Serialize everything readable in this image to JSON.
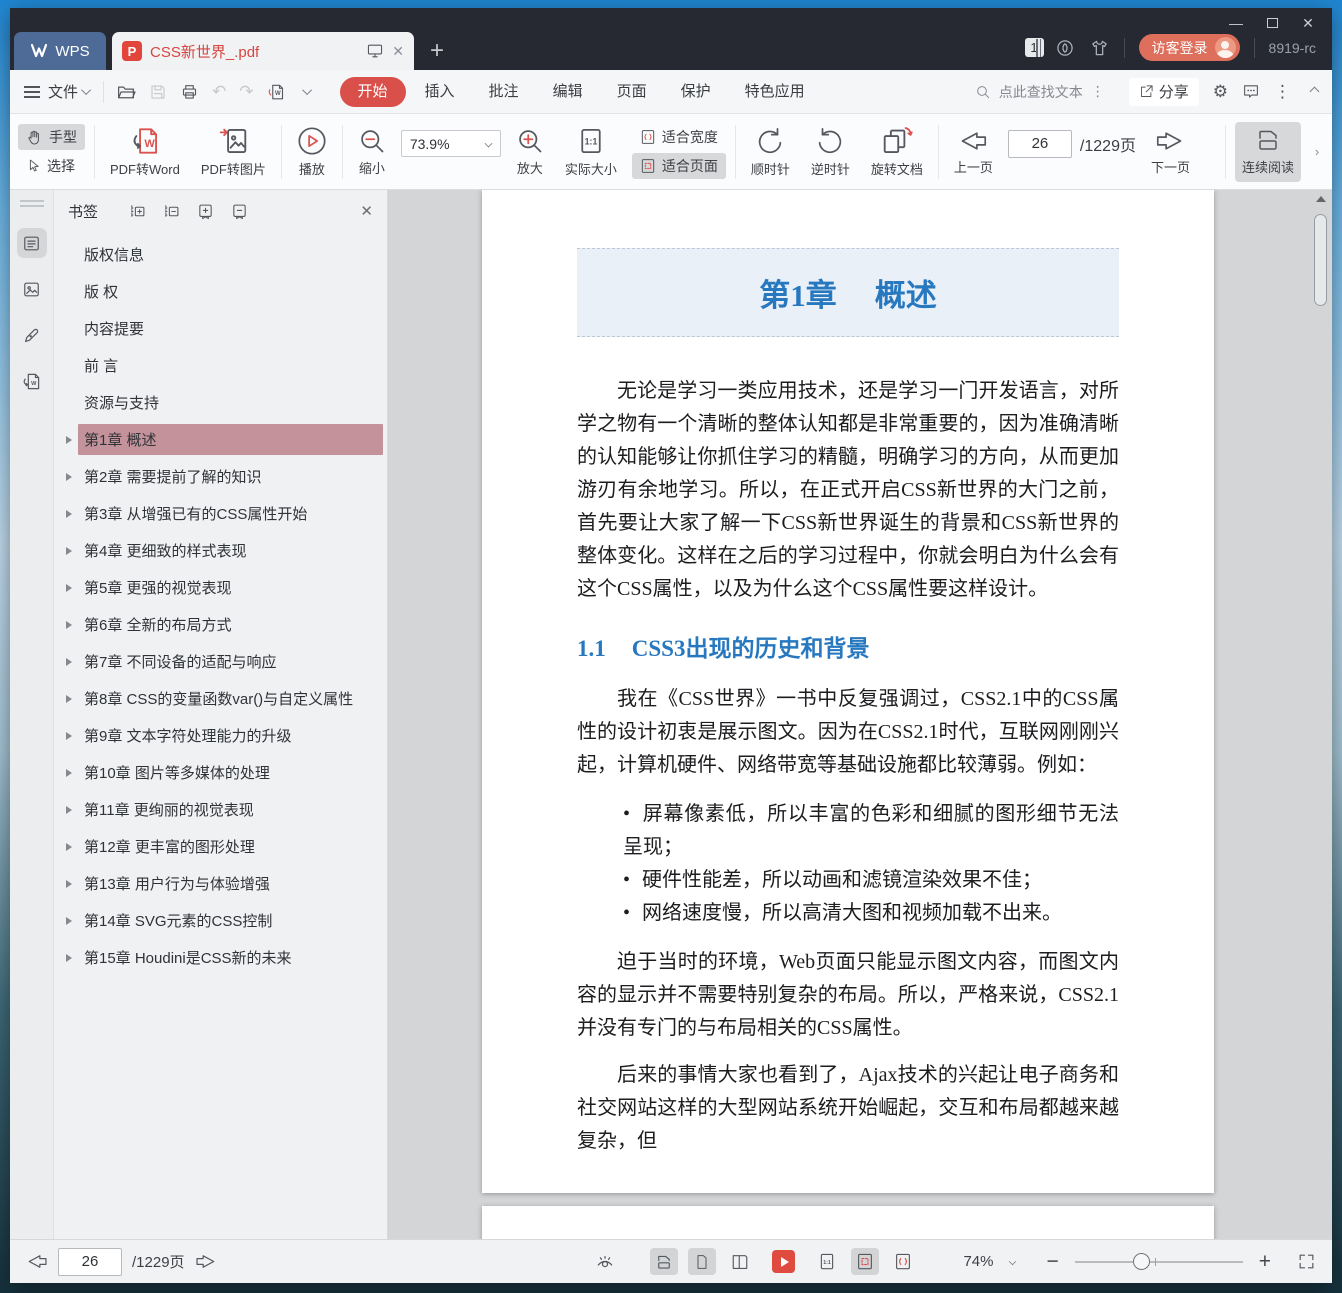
{
  "titlebar": {
    "wps_label": "WPS",
    "tab_title": "CSS新世界_.pdf",
    "new_tab": "+",
    "pages_badge": "1",
    "login_label": "访客登录",
    "build_label": "8919-rc",
    "controls": {
      "minimize": "—",
      "close": "✕"
    },
    "tab_close": "✕"
  },
  "menubar": {
    "file_label": "文件",
    "tabs": [
      {
        "label": "开始",
        "active": true
      },
      {
        "label": "插入",
        "active": false
      },
      {
        "label": "批注",
        "active": false
      },
      {
        "label": "编辑",
        "active": false
      },
      {
        "label": "页面",
        "active": false
      },
      {
        "label": "保护",
        "active": false
      },
      {
        "label": "特色应用",
        "active": false
      }
    ],
    "search_placeholder": "点此查找文本",
    "share_label": "分享",
    "undo_glyph": "↶",
    "redo_glyph": "↷",
    "gear_glyph": "⚙",
    "more_glyph": "⋮"
  },
  "toolbar": {
    "hand_label": "手型",
    "select_label": "选择",
    "pdf_to_word_label": "PDF转Word",
    "pdf_to_image_label": "PDF转图片",
    "play_label": "播放",
    "zoom_out_label": "缩小",
    "zoom_value": "73.9%",
    "zoom_in_label": "放大",
    "actual_size_label": "实际大小",
    "fit_width_label": "适合宽度",
    "fit_page_label": "适合页面",
    "rotate_cw_label": "顺时针",
    "rotate_ccw_label": "逆时针",
    "rotate_doc_label": "旋转文档",
    "prev_page_label": "上一页",
    "page_value": "26",
    "page_total": "/1229页",
    "next_page_label": "下一页",
    "continuous_label": "连续阅读",
    "collapse_glyph": "›"
  },
  "bookmarks": {
    "panel_title": "书签",
    "items": [
      {
        "label": "版权信息",
        "expandable": false,
        "active": false
      },
      {
        "label": "版 权",
        "expandable": false,
        "active": false
      },
      {
        "label": "内容提要",
        "expandable": false,
        "active": false
      },
      {
        "label": "前 言",
        "expandable": false,
        "active": false
      },
      {
        "label": "资源与支持",
        "expandable": false,
        "active": false
      },
      {
        "label": "第1章 概述",
        "expandable": true,
        "active": true
      },
      {
        "label": "第2章 需要提前了解的知识",
        "expandable": true,
        "active": false
      },
      {
        "label": "第3章 从增强已有的CSS属性开始",
        "expandable": true,
        "active": false
      },
      {
        "label": "第4章 更细致的样式表现",
        "expandable": true,
        "active": false
      },
      {
        "label": "第5章 更强的视觉表现",
        "expandable": true,
        "active": false
      },
      {
        "label": "第6章 全新的布局方式",
        "expandable": true,
        "active": false
      },
      {
        "label": "第7章 不同设备的适配与响应",
        "expandable": true,
        "active": false
      },
      {
        "label": "第8章 CSS的变量函数var()与自定义属性",
        "expandable": true,
        "active": false
      },
      {
        "label": "第9章 文本字符处理能力的升级",
        "expandable": true,
        "active": false
      },
      {
        "label": "第10章 图片等多媒体的处理",
        "expandable": true,
        "active": false
      },
      {
        "label": "第11章 更绚丽的视觉表现",
        "expandable": true,
        "active": false
      },
      {
        "label": "第12章 更丰富的图形处理",
        "expandable": true,
        "active": false
      },
      {
        "label": "第13章 用户行为与体验增强",
        "expandable": true,
        "active": false
      },
      {
        "label": "第14章 SVG元素的CSS控制",
        "expandable": true,
        "active": false
      },
      {
        "label": "第15章 Houdini是CSS新的未来",
        "expandable": true,
        "active": false
      }
    ]
  },
  "document": {
    "chapter_no": "第1章",
    "chapter_title": "概述",
    "para1": "无论是学习一类应用技术，还是学习一门开发语言，对所学之物有一个清晰的整体认知都是非常重要的，因为准确清晰的认知能够让你抓住学习的精髓，明确学习的方向，从而更加游刃有余地学习。所以，在正式开启CSS新世界的大门之前，首先要让大家了解一下CSS新世界诞生的背景和CSS新世界的整体变化。这样在之后的学习过程中，你就会明白为什么会有这个CSS属性，以及为什么这个CSS属性要这样设计。",
    "section_no": "1.1",
    "section_title": "CSS3出现的历史和背景",
    "para2": "我在《CSS世界》一书中反复强调过，CSS2.1中的CSS属性的设计初衷是展示图文。因为在CSS2.1时代，互联网刚刚兴起，计算机硬件、网络带宽等基础设施都比较薄弱。例如：",
    "bullets": [
      "屏幕像素低，所以丰富的色彩和细腻的图形细节无法呈现；",
      "硬件性能差，所以动画和滤镜渲染效果不佳；",
      "网络速度慢，所以高清大图和视频加载不出来。"
    ],
    "para3": "迫于当时的环境，Web页面只能显示图文内容，而图文内容的显示并不需要特别复杂的布局。所以，严格来说，CSS2.1并没有专门的与布局相关的CSS属性。",
    "para4": "后来的事情大家也看到了，Ajax技术的兴起让电子商务和社交网站这样的大型网站系统开始崛起，交互和布局都越来越复杂，但"
  },
  "statusbar": {
    "page_value": "26",
    "page_total": "/1229页",
    "zoom_value": "74%"
  },
  "colors": {
    "accent_red": "#d9534f",
    "heading_blue": "#2878bf",
    "bookmark_highlight": "#c4929a",
    "wps_blue": "#4e6b97",
    "login_pill": "#dd6f5c",
    "titlebar": "#262932"
  }
}
